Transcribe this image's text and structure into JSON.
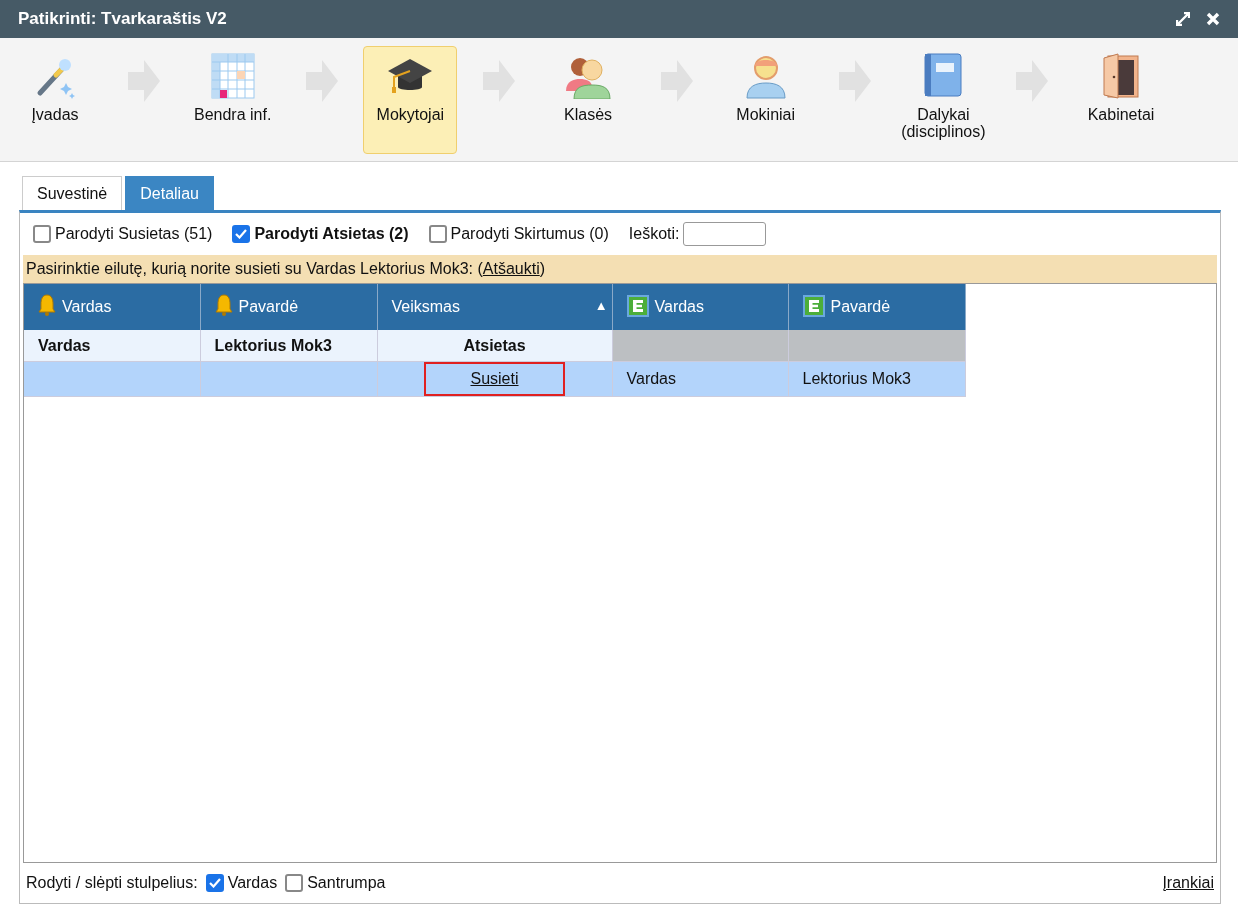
{
  "window": {
    "title": "Patikrinti: Tvarkaraštis V2"
  },
  "wizard_steps": [
    {
      "label": "Įvadas",
      "kind": "wand",
      "selected": false
    },
    {
      "label": "Bendra inf.",
      "kind": "calendar",
      "selected": false
    },
    {
      "label": "Mokytojai",
      "kind": "cap",
      "selected": true
    },
    {
      "label": "Klasės",
      "kind": "people",
      "selected": false
    },
    {
      "label": "Mokiniai",
      "kind": "person",
      "selected": false
    },
    {
      "label": "Dalykai (disciplinos)",
      "kind": "book",
      "selected": false
    },
    {
      "label": "Kabinetai",
      "kind": "door",
      "selected": false
    }
  ],
  "tabs": [
    {
      "label": "Suvestinė",
      "selected": false
    },
    {
      "label": "Detaliau",
      "selected": true
    }
  ],
  "filters": [
    {
      "label": "Parodyti Susietas (51)",
      "checked": false
    },
    {
      "label": "Parodyti Atsietas (2)",
      "checked": true
    },
    {
      "label": "Parodyti Skirtumus (0)",
      "checked": false
    }
  ],
  "search": {
    "label": "Ieškoti:"
  },
  "notice": {
    "text": "Pasirinktie eilutę, kurią norite susieti su Vardas Lektorius Mok3: (",
    "link": "Atšaukti",
    "text_end": ")"
  },
  "table": {
    "columns": [
      {
        "label": "Vardas",
        "kind": "bell"
      },
      {
        "label": "Pavardė",
        "kind": "bell"
      },
      {
        "label": "Veiksmas",
        "kind": "plain",
        "sort_mark": "▲"
      },
      {
        "label": "Vardas",
        "kind": "e"
      },
      {
        "label": "Pavardė",
        "kind": "e"
      }
    ],
    "rows": [
      {
        "kind": "source",
        "selected": false,
        "cells": [
          {
            "kind": "text",
            "text": "Vardas"
          },
          {
            "kind": "text",
            "text": "Lektorius Mok3"
          },
          {
            "kind": "status",
            "text": "Atsietas"
          },
          {
            "kind": "missing"
          },
          {
            "kind": "missing"
          }
        ]
      },
      {
        "kind": "candidate",
        "selected": true,
        "cells": [
          {
            "kind": "blank"
          },
          {
            "kind": "blank"
          },
          {
            "kind": "link",
            "text": "Susieti",
            "outlined": true
          },
          {
            "kind": "text",
            "text": "Vardas"
          },
          {
            "kind": "text",
            "text": "Lektorius Mok3"
          }
        ]
      }
    ]
  },
  "footer": {
    "label": "Rodyti / slėpti stulpelius:",
    "options": [
      {
        "label": "Vardas",
        "checked": true
      },
      {
        "label": "Santrumpa",
        "checked": false
      }
    ],
    "link": "Įrankiai"
  }
}
